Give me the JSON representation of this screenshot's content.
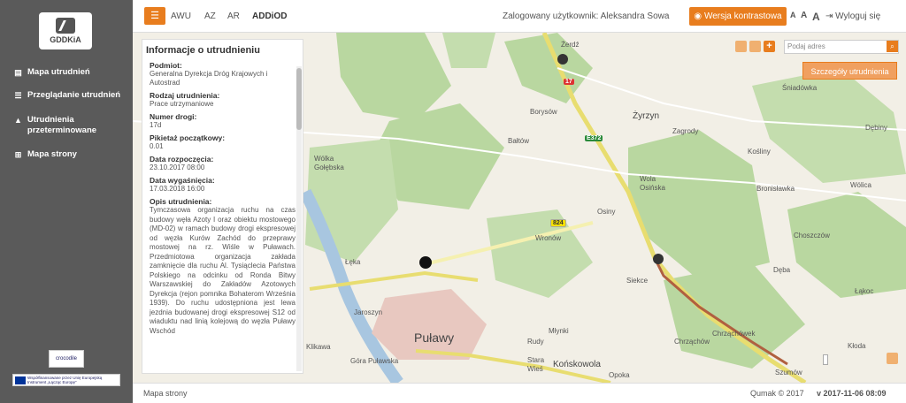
{
  "sidebar": {
    "logo_text": "GDDKiA",
    "items": [
      {
        "label": "Mapa utrudnień",
        "icon": "map-icon"
      },
      {
        "label": "Przeglądanie utrudnień",
        "icon": "list-icon"
      },
      {
        "label": "Utrudnienia przeterminowane",
        "icon": "warning-icon"
      },
      {
        "label": "Mapa strony",
        "icon": "sitemap-icon"
      }
    ],
    "logos": [
      "crocodile",
      "Współfinansowane przez Unię Europejską Instrument „Łącząc Europę”"
    ]
  },
  "header": {
    "menu_icon": "hamburger-icon",
    "langs": [
      "AWU",
      "AZ",
      "AR",
      "ADDiOD"
    ],
    "user_label": "Zalogowany użytkownik: Aleksandra Sowa",
    "contrast_label": "Wersja kontrastowa",
    "font_sizes": [
      "A",
      "A",
      "A"
    ],
    "logout_label": "Wyloguj się"
  },
  "panel": {
    "title": "Informacje o utrudnieniu",
    "fields": [
      {
        "label": "Podmiot:",
        "value": "Generalna Dyrekcja Dróg Krajowych i Autostrad"
      },
      {
        "label": "Rodzaj utrudnienia:",
        "value": "Prace utrzymaniowe"
      },
      {
        "label": "Numer drogi:",
        "value": "17d"
      },
      {
        "label": "Pikietaż początkowy:",
        "value": "0.01"
      },
      {
        "label": "Data rozpoczęcia:",
        "value": "23.10.2017 08:00"
      },
      {
        "label": "Data wygaśnięcia:",
        "value": "17.03.2018 16:00"
      },
      {
        "label": "Opis utrudnienia:",
        "value": "Tymczasowa organizacja ruchu na czas budowy węła Azoty I oraz obiektu mostowego (MD-02) w ramach budowy drogi ekspresowej od węzła Kurów Zachód do przeprawy mostowej na rz. Wiśle w Puławach. Przedmiotowa organizacja zakłada zamknięcie dla ruchu Al. Tysiąclecia Państwa Polskiego na odcinku od Ronda Bitwy Warszawskiej do Zakładów Azotowych Dyrekcja (rejon pomnika Bohaterom Września 1939). Do ruchu udostępniona jest lewa jezdnia budowanej drogi ekspresowej S12 od wiaduktu nad linią kolejową do węzła Puławy Wschód"
      }
    ]
  },
  "map": {
    "search_placeholder": "Podaj adres",
    "details_label": "Szczegóły utrudnienia",
    "places": [
      "Żerdź",
      "Borysów",
      "Żyrzyn",
      "Zagrody",
      "Bałtów",
      "Śniadówka",
      "Dębiny",
      "Kośliny",
      "Wólka Gołębska",
      "Wola Osińska",
      "Bronisławka",
      "Wólica",
      "Osiny",
      "Wronów",
      "Choszczów",
      "Łęka",
      "Dęba",
      "Siekce",
      "Łąkoc",
      "Jaroszyn",
      "Puławy",
      "Młynki",
      "Rudy",
      "Chrząchówek",
      "Chrząchów",
      "Kłoda",
      "Klikawa",
      "Góra Puławska",
      "Stara Wieś",
      "Końskowola",
      "Opoka",
      "Szumów"
    ],
    "road_labels": [
      "17",
      "E372",
      "824"
    ]
  },
  "footer": {
    "sitemap_label": "Mapa strony",
    "copyright": "Qumak © 2017",
    "version": "v 2017-11-06 08:09"
  }
}
